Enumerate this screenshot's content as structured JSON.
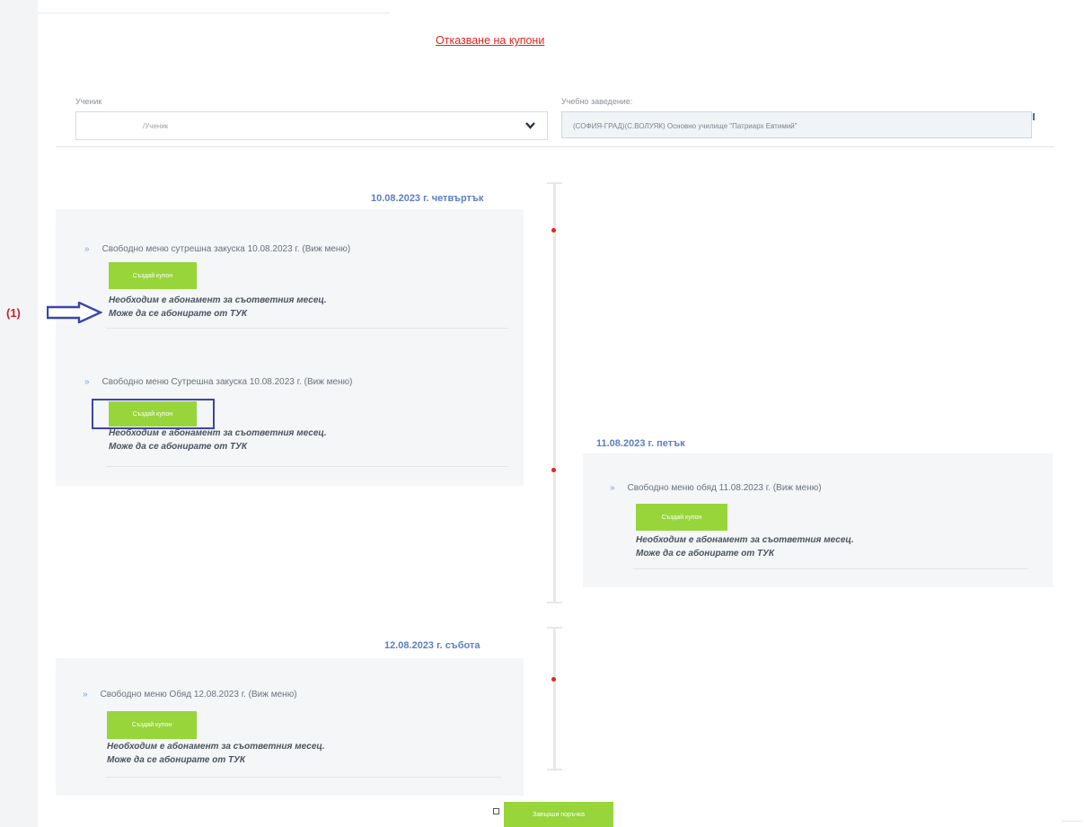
{
  "page": {
    "cancel_link": "Отказване на купони",
    "student_label": "Ученик",
    "student_value": "/Ученик",
    "school_label": "Учебно заведение:",
    "school_value": "(СОФИЯ-ГРАД)(С.ВОЛУЯК) Основно училище \"Патриарх Евтимий\"",
    "finish_button": "Завърши поръчка"
  },
  "annotation": {
    "label": "(1)"
  },
  "days": [
    {
      "date": "10.08.2023 г. четвъртък",
      "entries": [
        {
          "arrow": "»",
          "title": "Свободно меню сутрешна закуска 10.08.2023 г. (Виж меню)",
          "button": "Създай купон",
          "note_line1": "Необходим е абонамент за съответния месец.",
          "note_line2": "Може да се абонирате от ТУК"
        },
        {
          "arrow": "»",
          "title": "Свободно меню Сутрешна закуска 10.08.2023 г. (Виж меню)",
          "button": "Създай купон",
          "note_line1": "Необходим е абонамент за съответния месец.",
          "note_line2": "Може да се абонирате от ТУК"
        }
      ]
    },
    {
      "date": "11.08.2023 г. петък",
      "entries": [
        {
          "arrow": "»",
          "title": "Свободно меню обяд 11.08.2023 г. (Виж меню)",
          "button": "Създай купон",
          "note_line1": "Необходим е абонамент за съответния месец.",
          "note_line2": "Може да се абонирате от ТУК"
        }
      ]
    },
    {
      "date": "12.08.2023 г. събота",
      "entries": [
        {
          "arrow": "»",
          "title": "Свободно меню Обяд 12.08.2023 г. (Виж меню)",
          "button": "Създай купон",
          "note_line1": "Необходим е абонамент за съответния месец.",
          "note_line2": "Може да се абонирате от ТУК"
        }
      ]
    }
  ],
  "colors": {
    "accent_green": "#97d53b",
    "link_red": "#e0261d",
    "date_blue": "#5b7fbf",
    "annotation_blue": "#3b46a6",
    "annotation_red": "#c0272d"
  },
  "icons": {
    "dropdown": "chevron-down-icon",
    "entry": "double-chevron-right-icon",
    "annotation": "arrow-right-outline-icon"
  }
}
